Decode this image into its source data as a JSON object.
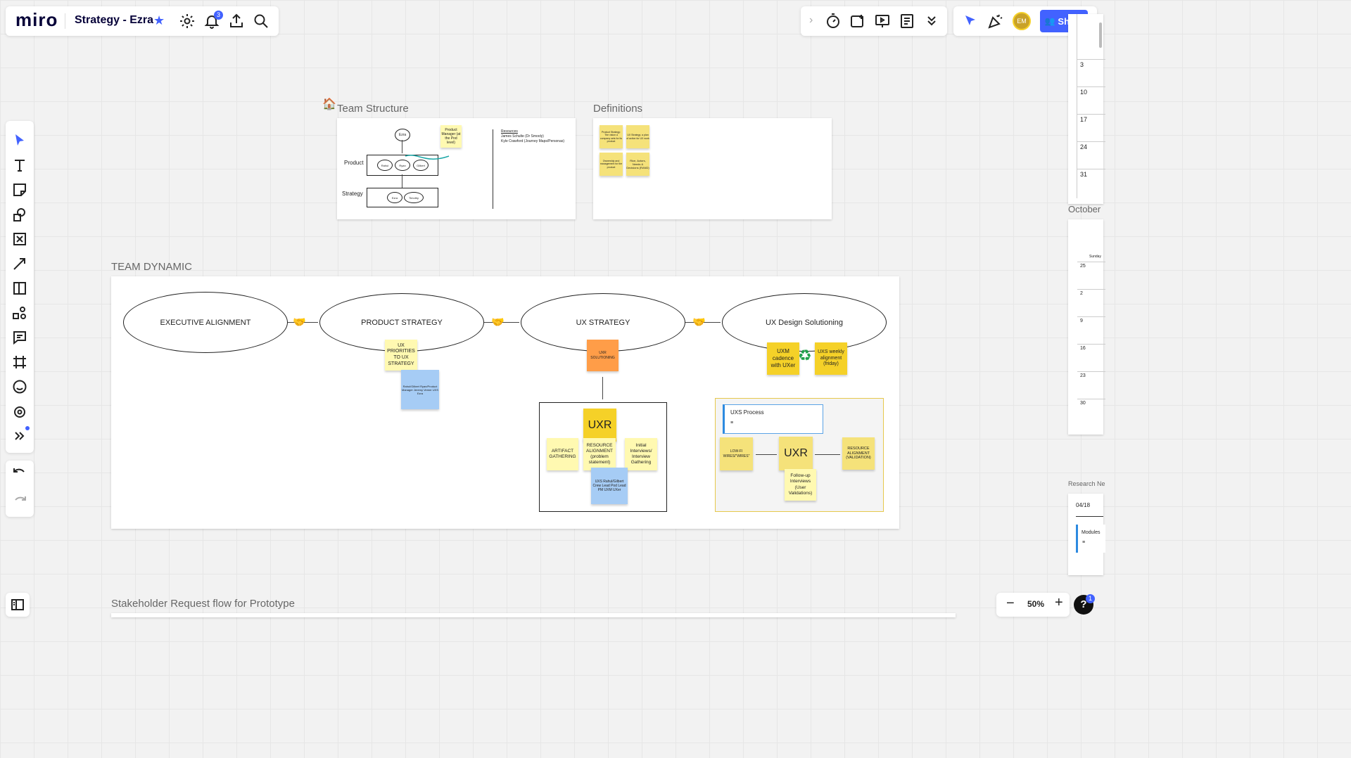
{
  "app": {
    "logo": "miro",
    "board_title": "Strategy - Ezra",
    "notifications_count": "3",
    "help_badge": "1"
  },
  "toolbar_right": {
    "share_label": "Share",
    "avatar_initials": "EM"
  },
  "zoom": {
    "level": "50%"
  },
  "frames": {
    "team_structure": {
      "title": "Team Structure",
      "product_label": "Product",
      "strategy_label": "Strategy",
      "top_node": "Ezra",
      "product_nodes": [
        "Rahul",
        "Ryan",
        "Gilbert"
      ],
      "strategy_nodes": [
        "Ezra",
        "Timothy"
      ],
      "sticky": "Product Manager (at the Pod level)",
      "resources_heading": "Resources",
      "resources": [
        "James Schulte (Dr Smooly)",
        "Kyle Crawford (Journey Maps/Personas)"
      ]
    },
    "definitions": {
      "title": "Definitions",
      "stickies": [
        "Product Strategy: The vision a company sets for its product",
        "UX Strategy: a plan of action for UX work",
        "Ownership and management for the product",
        "Rice, Actors, Needs & Decisions (RAND)"
      ]
    },
    "team_dynamic": {
      "title": "TEAM DYNAMIC",
      "stages": [
        "EXECUTIVE ALIGNMENT",
        "PRODUCT STRATEGY",
        "UX STRATEGY",
        "UX Design Solutioning"
      ],
      "ux_priorities": "UX PRIORITIES TO UX STRATEGY",
      "blue_note": "Rahul/Gilbert Ryan/Product Manager Jeremy Vemer UXS Ezra",
      "uxr_solutioning": "UXR SOLUTIONING",
      "uxm_cadence": "UXM cadence with UXer",
      "uxs_weekly": "UXS weekly alignment (friday)",
      "uxr": "UXR",
      "artifact_gathering": "ARTIFACT GATHERING",
      "resource_alignment": "RESOURCE ALIGNMENT (problem statement)",
      "initial_interviews": "Initial Interviews/ Interview Gathering",
      "uxr_blue_note": "UXS Rahul/Gilbert Crew Lead Pod Lead PM UXM UXer",
      "uxs_process": "UXS Process",
      "lowfi": "LOW-FI WIRES/\"WIRES\"",
      "resource_validation": "RESOURCE ALIGNMENT (VALIDATION)",
      "followup": "Follow-up Interviews (User Validations)"
    },
    "stakeholder": {
      "title": "Stakeholder Request flow for Prototype"
    }
  },
  "calendar": {
    "month_label": "October",
    "top_days": [
      "3",
      "10",
      "17",
      "24",
      "31"
    ],
    "weekday": "Sunday",
    "bottom_days": [
      "25",
      "2",
      "9",
      "16",
      "23",
      "30"
    ]
  },
  "research": {
    "title": "Research Ne",
    "date": "04/18",
    "modules": "Modules"
  },
  "colors": {
    "accent": "#4262ff",
    "sticky_yellow": "#fff9b1",
    "sticky_orange": "#ff9d48",
    "sticky_blue": "#a6ccf5"
  }
}
